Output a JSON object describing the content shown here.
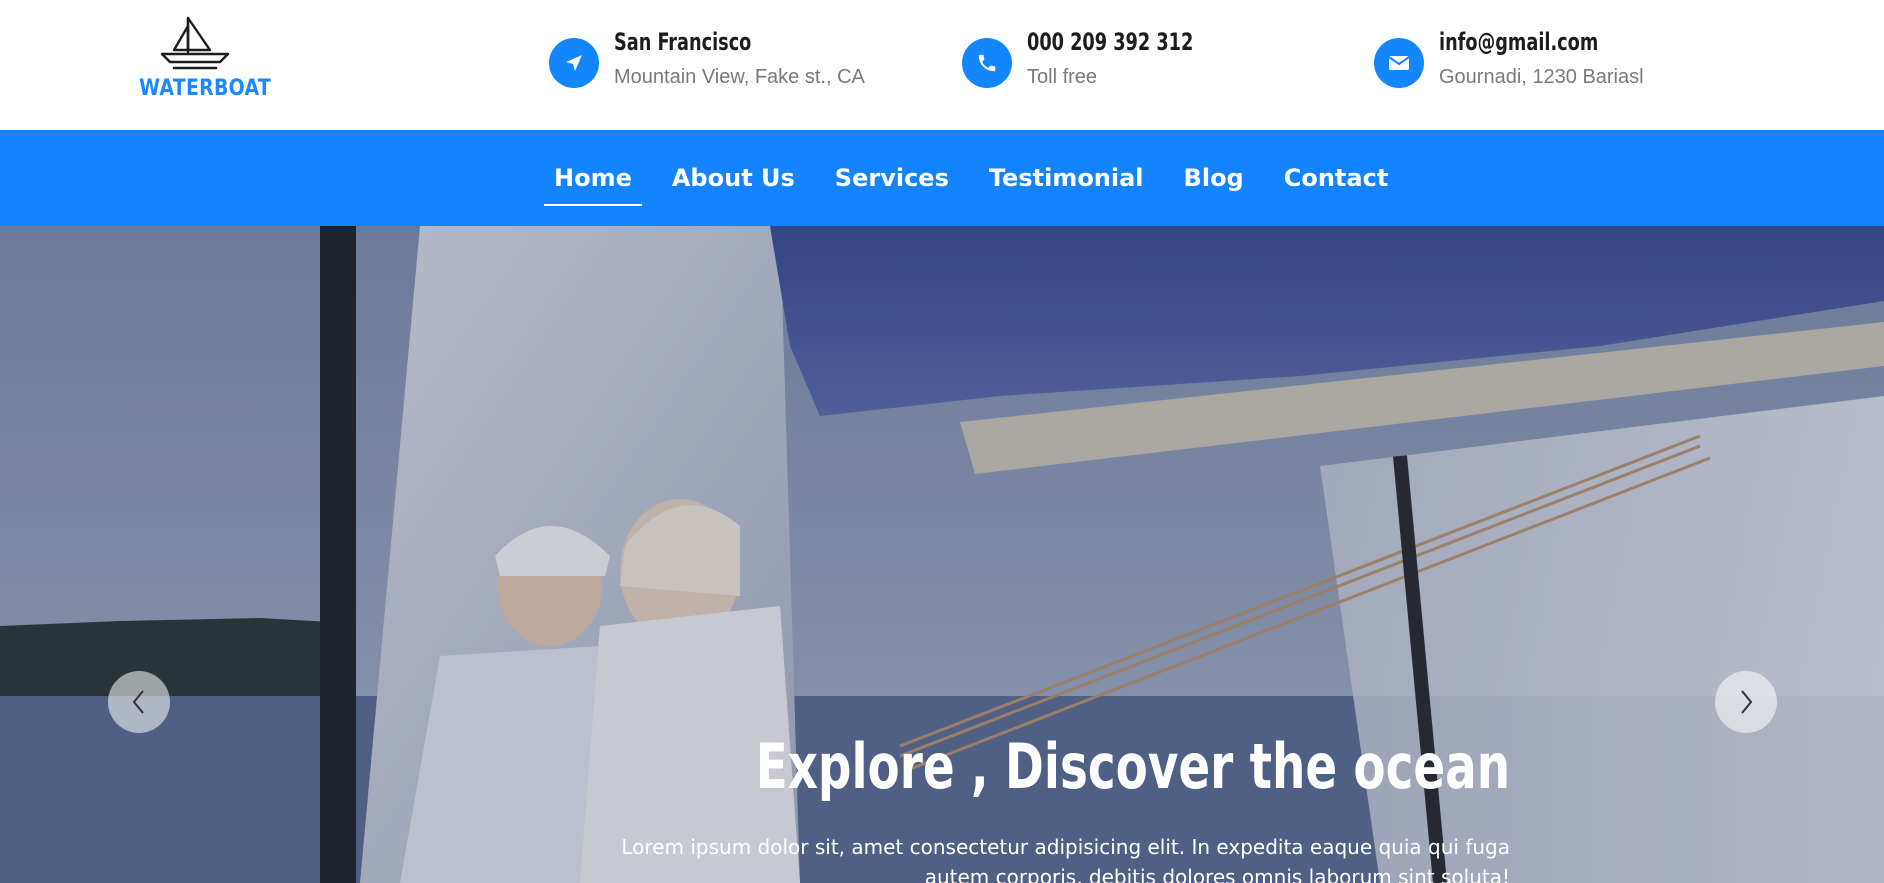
{
  "brand": {
    "name": "WATERBOAT",
    "logo_icon": "sailboat-icon",
    "accent": "#1386fe"
  },
  "contacts": [
    {
      "icon": "location-arrow-icon",
      "title": "San Francisco",
      "subtitle": "Mountain View, Fake st., CA"
    },
    {
      "icon": "phone-icon",
      "title": "000 209 392 312",
      "subtitle": "Toll free"
    },
    {
      "icon": "envelope-icon",
      "title": "info@gmail.com",
      "subtitle": "Gournadi, 1230 Bariasl"
    }
  ],
  "nav": {
    "background": "#1384fe",
    "active": "Home",
    "items": [
      "Home",
      "About Us",
      "Services",
      "Testimonial",
      "Blog",
      "Contact"
    ]
  },
  "hero": {
    "title": "Explore , Discover the ocean",
    "text": "Lorem ipsum dolor sit, amet consectetur adipisicing elit. In expedita eaque quia qui fuga autem corporis, debitis dolores omnis laborum sint soluta!",
    "prev_icon": "chevron-left-icon",
    "next_icon": "chevron-right-icon"
  }
}
